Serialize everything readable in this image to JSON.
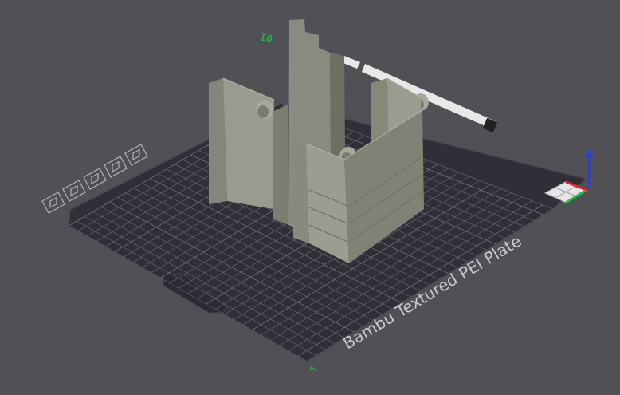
{
  "app": "Bambu Studio 3D preview",
  "plate": {
    "name": "Bambu Textured PEI Plate",
    "plate_number": "01",
    "corner_marker": "7"
  },
  "toolbar": {
    "items": [
      {
        "name": "close-plate-icon"
      },
      {
        "name": "plate-lock-icon"
      },
      {
        "name": "arrange-icon"
      },
      {
        "name": "orient-icon"
      },
      {
        "name": "plate-settings-icon"
      }
    ]
  },
  "axis_gizmo": {
    "x_color": "#e0262a",
    "y_color": "#1ec34a",
    "z_color": "#2b3fd8"
  },
  "colors": {
    "background": "#505055",
    "plate": "#2f2f37",
    "model": "#8d8e82"
  }
}
